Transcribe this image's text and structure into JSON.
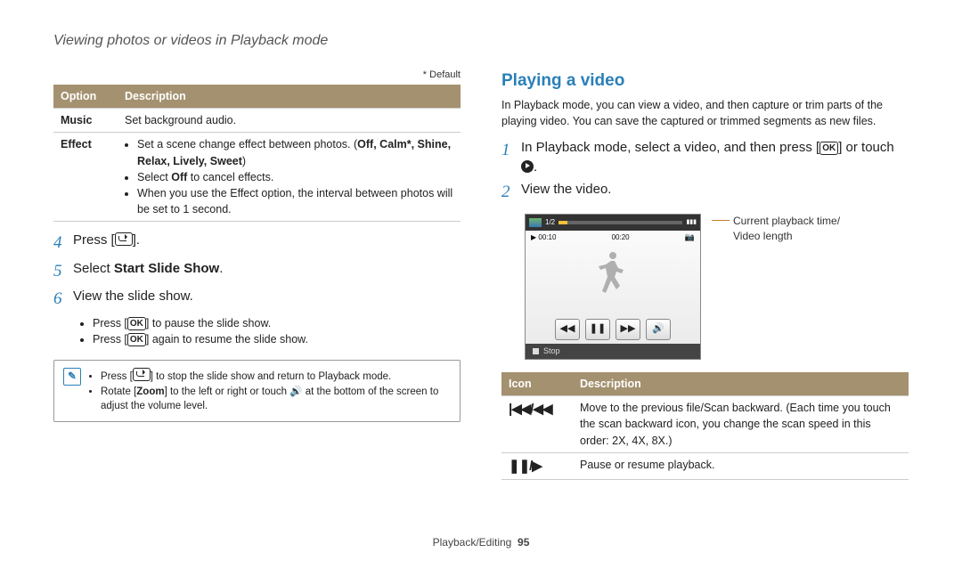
{
  "header": "Viewing photos or videos in Playback mode",
  "left": {
    "default_note": "* Default",
    "table": {
      "head": {
        "c1": "Option",
        "c2": "Description"
      },
      "rows": [
        {
          "opt": "Music",
          "desc_plain": "Set background audio."
        },
        {
          "opt": "Effect",
          "desc_bullets": [
            {
              "pre": "Set a scene change effect between photos. (",
              "bold": "Off, Calm*, Shine, Relax, Lively, Sweet",
              "post": ")"
            },
            {
              "pre": "Select ",
              "bold": "Off",
              "post": " to cancel effects."
            },
            {
              "pre": "When you use the Effect option, the interval between photos will be set to 1 second.",
              "bold": "",
              "post": ""
            }
          ]
        }
      ]
    },
    "steps": [
      {
        "n": "4",
        "pre": "Press [",
        "icon": "return",
        "post": "]."
      },
      {
        "n": "5",
        "pre": "Select ",
        "bold": "Start Slide Show",
        "post": "."
      },
      {
        "n": "6",
        "pre": "View the slide show.",
        "post": ""
      }
    ],
    "substeps": [
      {
        "pre": "Press [",
        "icon": "OK",
        "post": "] to pause the slide show."
      },
      {
        "pre": "Press [",
        "icon": "OK",
        "post": "] again to resume the slide show."
      }
    ],
    "note": [
      {
        "parts": [
          "Press [",
          {
            "icon": "return"
          },
          "] to stop the slide show and return to Playback mode."
        ]
      },
      {
        "parts": [
          "Rotate [",
          {
            "bold": "Zoom"
          },
          "] to the left or right or touch ",
          {
            "icon": "speaker"
          },
          " at the bottom of the screen to adjust the volume level."
        ]
      }
    ]
  },
  "right": {
    "title": "Playing a video",
    "intro": "In Playback mode, you can view a video, and then capture or trim parts of the playing video. You can save the captured or trimmed segments as new files.",
    "steps": [
      {
        "n": "1",
        "pre": "In Playback mode, select a video, and then press [",
        "icon": "OK",
        "mid": "] or touch ",
        "icon2": "play",
        "post": "."
      },
      {
        "n": "2",
        "pre": "View the video.",
        "post": ""
      }
    ],
    "player": {
      "count": "1/2",
      "t1": "00:10",
      "t2": "00:20",
      "stop": "Stop"
    },
    "anno1": "Current playback time/",
    "anno2": "Video length",
    "table": {
      "head": {
        "c1": "Icon",
        "c2": "Description"
      },
      "rows": [
        {
          "iconset": "|◀◀/◀◀",
          "desc": "Move to the previous file/Scan backward. (Each time you touch the scan backward icon, you change the scan speed in this order: 2X, 4X, 8X.)"
        },
        {
          "iconset": "❚❚/▶",
          "desc": "Pause or resume playback."
        }
      ]
    }
  },
  "footer": {
    "a": "Playback/Editing",
    "b": "95"
  }
}
